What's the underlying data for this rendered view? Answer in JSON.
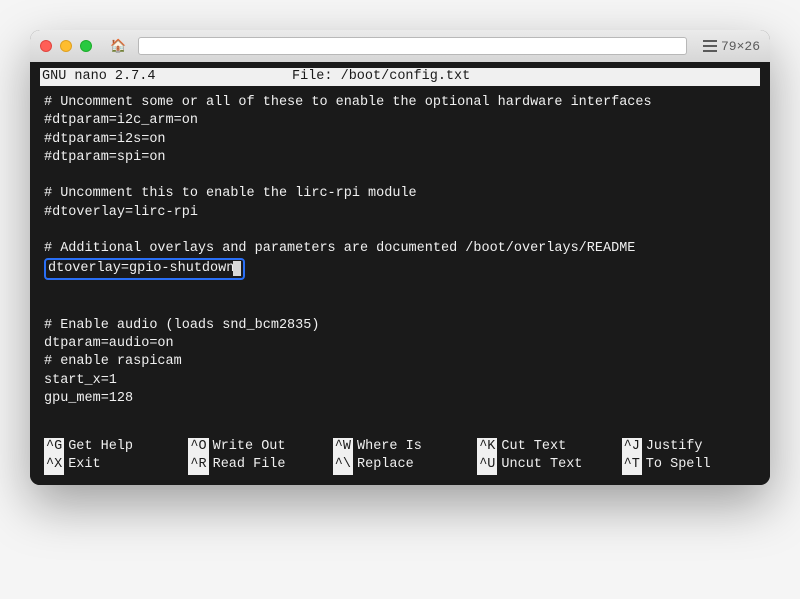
{
  "window": {
    "dimensions_label": "79×26"
  },
  "nano": {
    "app_label": "GNU nano 2.7.4",
    "file_label": "File: /boot/config.txt"
  },
  "content": {
    "l1": "# Uncomment some or all of these to enable the optional hardware interfaces",
    "l2": "#dtparam=i2c_arm=on",
    "l3": "#dtparam=i2s=on",
    "l4": "#dtparam=spi=on",
    "l5": "# Uncomment this to enable the lirc-rpi module",
    "l6": "#dtoverlay=lirc-rpi",
    "l7": "# Additional overlays and parameters are documented /boot/overlays/README",
    "l8": "dtoverlay=gpio-shutdown",
    "l9": "# Enable audio (loads snd_bcm2835)",
    "l10": "dtparam=audio=on",
    "l11": "# enable raspicam",
    "l12": "start_x=1",
    "l13": "gpu_mem=128"
  },
  "shortcuts": [
    {
      "key": "^G",
      "label": "Get Help"
    },
    {
      "key": "^O",
      "label": "Write Out"
    },
    {
      "key": "^W",
      "label": "Where Is"
    },
    {
      "key": "^K",
      "label": "Cut Text"
    },
    {
      "key": "^J",
      "label": "Justify"
    },
    {
      "key": "^X",
      "label": "Exit"
    },
    {
      "key": "^R",
      "label": "Read File"
    },
    {
      "key": "^\\",
      "label": "Replace"
    },
    {
      "key": "^U",
      "label": "Uncut Text"
    },
    {
      "key": "^T",
      "label": "To Spell"
    }
  ]
}
